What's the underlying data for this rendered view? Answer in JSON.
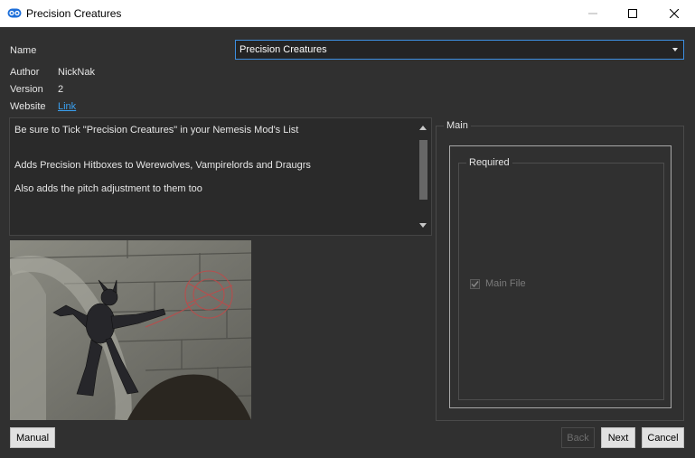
{
  "window": {
    "title": "Precision Creatures",
    "icons": {
      "app": "app-logo-icon",
      "minimize": "minimize-icon",
      "maximize": "maximize-icon",
      "close": "close-icon"
    }
  },
  "mod": {
    "name_label": "Name",
    "name_value": "Precision Creatures",
    "author_label": "Author",
    "author_value": "NickNak",
    "version_label": "Version",
    "version_value": "2",
    "website_label": "Website",
    "website_link": "Link"
  },
  "description": {
    "line1": "Be sure to Tick \"Precision Creatures\" in your Nemesis Mod's List",
    "line2": "Adds Precision Hitboxes to Werewolves, Vampirelords and Draugrs",
    "line3": "Also adds the pitch adjustment to them too"
  },
  "options": {
    "group_title": "Main",
    "subgroup_title": "Required",
    "checkbox_label": "Main File",
    "checkbox_checked": true
  },
  "buttons": {
    "manual": "Manual",
    "back": "Back",
    "next": "Next",
    "cancel": "Cancel"
  },
  "colors": {
    "accent": "#3d8ee0",
    "link": "#3aa0f0",
    "background": "#303030"
  }
}
